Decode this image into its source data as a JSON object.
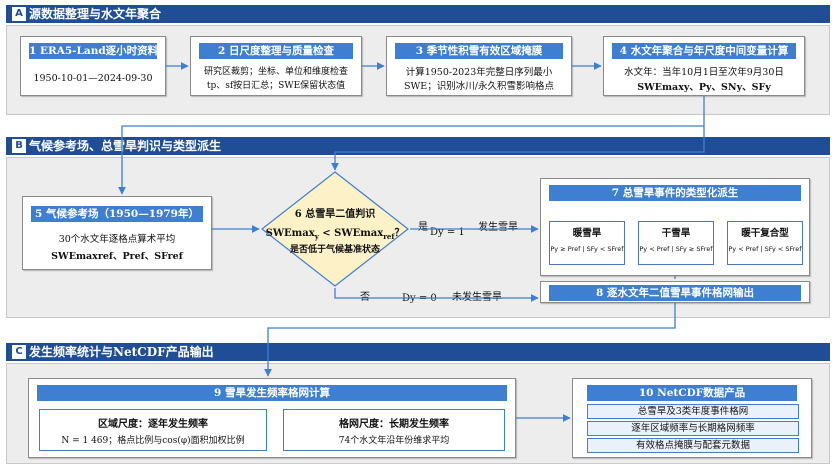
{
  "sections": {
    "a": {
      "letter": "A",
      "title": "源数据整理与水文年聚合"
    },
    "b": {
      "letter": "B",
      "title": "气候参考场、总雪旱判识与类型派生"
    },
    "c": {
      "letter": "C",
      "title": "发生频率统计与NetCDF产品输出"
    }
  },
  "step1": {
    "title": "1 ERA5-Land逐小时资料",
    "line1": "1950-10-01—2024-09-30"
  },
  "step2": {
    "title": "2 日尺度整理与质量检查",
    "line1": "研究区裁剪；坐标、单位和维度检查",
    "line2": "tp、sf按日汇总；SWE保留状态值"
  },
  "step3": {
    "title": "3 季节性积雪有效区域掩膜",
    "line1": "计算1950-2023年完整日序列最小",
    "line2": "SWE；识别冰川/永久积雪影响格点"
  },
  "step4": {
    "title": "4 水文年聚合与年尺度中间变量计算",
    "line1": "水文年：当年10月1日至次年9月30日",
    "line2": "SWEmaxy、Py、SNy、SFy"
  },
  "step5": {
    "title": "5 气候参考场（1950—1979年）",
    "line1": "30个水文年逐格点算术平均",
    "line2": "SWEmaxref、Pref、SFref"
  },
  "step6": {
    "title": "6 总雪旱二值判识",
    "formula_left": "SWEmax",
    "formula_sub_y": "y",
    "formula_mid": " < SWEmax",
    "formula_sub_ref": "ref",
    "formula_end": "？",
    "note": "是否低于气候基准状态"
  },
  "decision": {
    "yes_label": "是",
    "no_label": "否",
    "d1": "Dy = 1",
    "d0": "Dy = 0",
    "occurred": "发生雪旱",
    "not_occurred": "未发生雪旱"
  },
  "step7": {
    "title": "7 总雪旱事件的类型化派生",
    "types": [
      {
        "name": "暖雪旱",
        "formula": "Py ≥ Pref | SFy < SFref"
      },
      {
        "name": "干雪旱",
        "formula": "Py < Pref | SFy ≥ SFref"
      },
      {
        "name": "暖干复合型",
        "formula": "Py < Pref | SFy < SFref"
      }
    ]
  },
  "step8": {
    "title": "8 逐水文年二值雪旱事件格网输出"
  },
  "step9": {
    "title": "9 雪旱发生频率格网计算",
    "regional": {
      "title": "区域尺度：逐年发生频率",
      "line": "N = 1 469；格点比例与cos(φ)面积加权比例"
    },
    "grid": {
      "title": "格网尺度：长期发生频率",
      "line": "74个水文年沿年份维求平均"
    }
  },
  "step10": {
    "title": "10 NetCDF数据产品",
    "items": [
      "总雪旱及3类年度事件格网",
      "逐年区域频率与长期格网频率",
      "有效格点掩膜与配套元数据"
    ]
  },
  "colors": {
    "section_bar": "#1f4e96",
    "card_title": "#3f7fd1",
    "diamond_fill": "#fdf1c8",
    "connector": "#3f7fd1"
  }
}
